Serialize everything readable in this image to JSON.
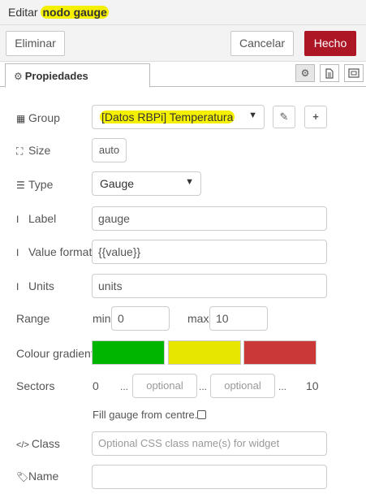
{
  "header": {
    "title_prefix": "Editar ",
    "title_highlight": "nodo gauge"
  },
  "buttons": {
    "delete": "Eliminar",
    "cancel": "Cancelar",
    "done": "Hecho"
  },
  "tabs": {
    "properties": "Propiedades",
    "icons": [
      "gear-icon",
      "file-text-icon",
      "frame-icon"
    ]
  },
  "form": {
    "group": {
      "label": "Group",
      "value": "[Datos RBPi] Temperatura",
      "icon": "table-icon"
    },
    "size": {
      "label": "Size",
      "value": "auto",
      "icon": "resize-icon"
    },
    "type": {
      "label": "Type",
      "value": "Gauge",
      "icon": "list-icon"
    },
    "label": {
      "label": "Label",
      "value": "gauge",
      "icon": "text-cursor-icon"
    },
    "value_format": {
      "label": "Value format",
      "value": "{{value}}",
      "icon": "text-cursor-icon"
    },
    "units": {
      "label": "Units",
      "value": "units",
      "icon": "text-cursor-icon"
    },
    "range": {
      "label": "Range",
      "min_label": "min",
      "min_value": "0",
      "max_label": "max",
      "max_value": "10"
    },
    "colour_gradient": {
      "label": "Colour gradient",
      "colors": [
        "#00b500",
        "#e6e600",
        "#ca3838"
      ]
    },
    "sectors": {
      "label": "Sectors",
      "start": "0",
      "dots": "...",
      "sep": "...",
      "end_dots": "...",
      "placeholder_1": "optional",
      "placeholder_2": "optional",
      "end": "10"
    },
    "fill_gauge": {
      "label": "Fill gauge from centre.",
      "checked": false
    },
    "class": {
      "label": "Class",
      "placeholder": "Optional CSS class name(s) for widget",
      "icon": "code-icon"
    },
    "name": {
      "label": "Name",
      "value": "",
      "icon": "tag-icon"
    }
  },
  "colors": {
    "highlight": "#f5f000",
    "done_button": "#ad1625"
  }
}
